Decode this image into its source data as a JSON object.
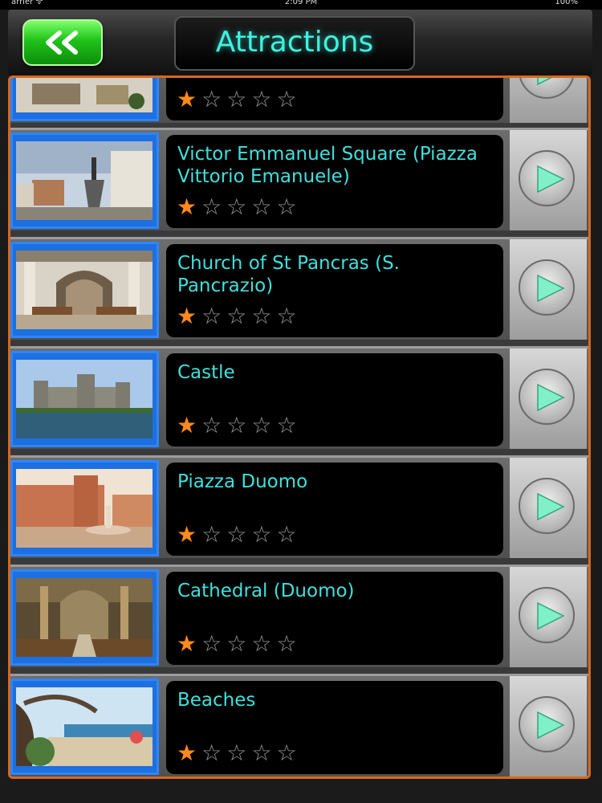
{
  "status_bar": {
    "carrier": "arrier ᯤ",
    "time": "2:09 PM",
    "battery": "100%"
  },
  "navbar": {
    "title": "Attractions",
    "back_icon": "double-chevron-left-icon"
  },
  "colors": {
    "title": "#3ef2e0",
    "item_text": "#3fe0dc",
    "star_on": "#ff8a1a",
    "frame_accent": "#d8681e",
    "thumb_border": "#2c86ff",
    "back_button": "#1fc21a"
  },
  "attractions": [
    {
      "name": "",
      "rating": 1
    },
    {
      "name": "Victor Emmanuel Square (Piazza Vittorio Emanuele)",
      "rating": 1
    },
    {
      "name": "Church of St Pancras (S. Pancrazio)",
      "rating": 1
    },
    {
      "name": "Castle",
      "rating": 1
    },
    {
      "name": "Piazza Duomo",
      "rating": 1
    },
    {
      "name": "Cathedral (Duomo)",
      "rating": 1
    },
    {
      "name": "Beaches",
      "rating": 1
    }
  ],
  "rating_max": 5,
  "stars": {
    "on": "★",
    "off": "☆"
  }
}
